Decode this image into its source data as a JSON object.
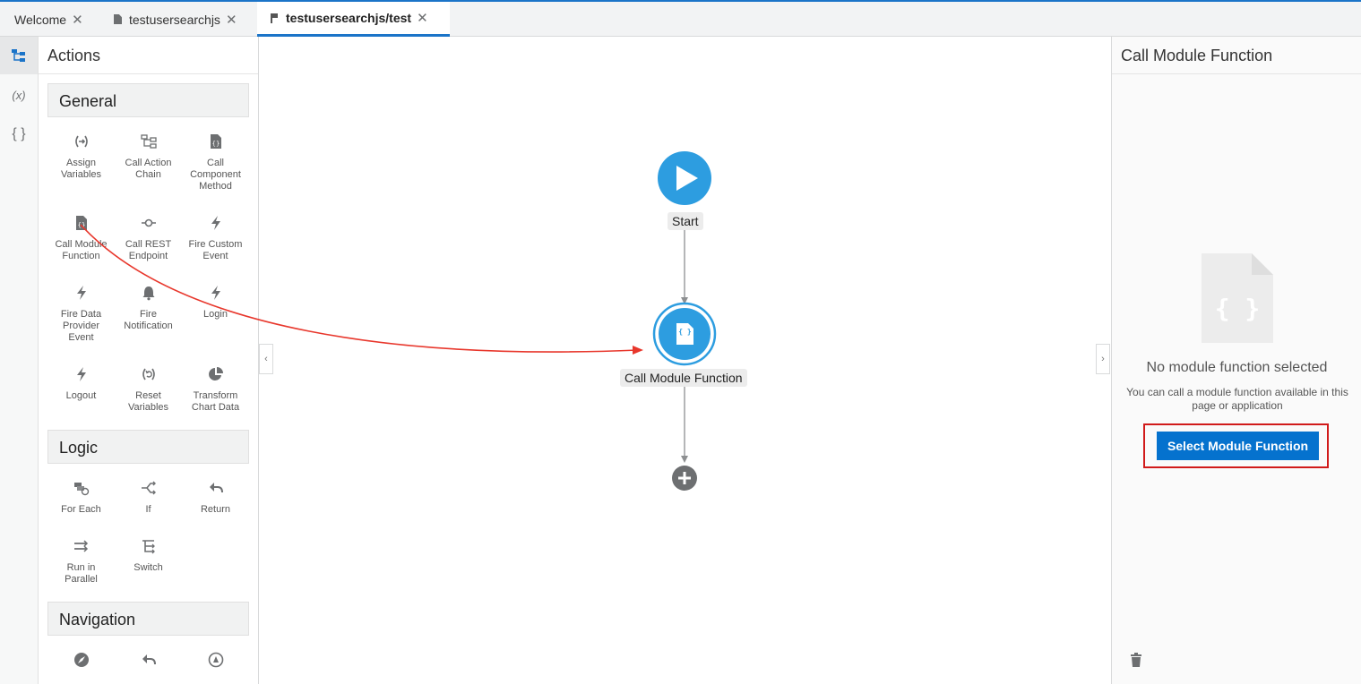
{
  "tabs": [
    {
      "label": "Welcome",
      "close": "✕"
    },
    {
      "label": "testusersearchjs",
      "close": "✕"
    },
    {
      "label": "testusersearchjs/test",
      "close": "✕"
    }
  ],
  "rail": {
    "variables_label": "(x)",
    "json_label": "{ }"
  },
  "palette": {
    "title": "Actions",
    "sections": {
      "general": "General",
      "logic": "Logic",
      "navigation": "Navigation"
    },
    "general_items": [
      {
        "label": "Assign\nVariables",
        "icon": "assign-variables-icon"
      },
      {
        "label": "Call Action\nChain",
        "icon": "action-chain-icon"
      },
      {
        "label": "Call\nComponent\nMethod",
        "icon": "component-method-icon"
      },
      {
        "label": "Call Module\nFunction",
        "icon": "module-function-icon"
      },
      {
        "label": "Call REST\nEndpoint",
        "icon": "rest-endpoint-icon"
      },
      {
        "label": "Fire Custom\nEvent",
        "icon": "lightning-icon"
      },
      {
        "label": "Fire Data\nProvider\nEvent",
        "icon": "lightning-icon"
      },
      {
        "label": "Fire\nNotification",
        "icon": "bell-icon"
      },
      {
        "label": "Login",
        "icon": "lightning-icon"
      },
      {
        "label": "Logout",
        "icon": "lightning-icon"
      },
      {
        "label": "Reset\nVariables",
        "icon": "reset-icon"
      },
      {
        "label": "Transform\nChart Data",
        "icon": "pie-chart-icon"
      }
    ],
    "logic_items": [
      {
        "label": "For Each",
        "icon": "for-each-icon"
      },
      {
        "label": "If",
        "icon": "if-icon"
      },
      {
        "label": "Return",
        "icon": "return-icon"
      },
      {
        "label": "Run in\nParallel",
        "icon": "parallel-icon"
      },
      {
        "label": "Switch",
        "icon": "switch-icon"
      }
    ]
  },
  "canvas": {
    "start_label": "Start",
    "node_label": "Call Module Function",
    "node_glyph": "{ }"
  },
  "right_panel": {
    "title": "Call Module Function",
    "empty_title": "No module function selected",
    "empty_desc": "You can call a module function available in this page or application",
    "select_button": "Select Module Function",
    "placeholder_glyph": "{ }"
  },
  "colors": {
    "accent": "#1b74c8",
    "node_blue": "#2d9de0",
    "button_blue": "#0572ce",
    "highlight_red": "#d11a1a",
    "arrow_red": "#e8372c"
  }
}
